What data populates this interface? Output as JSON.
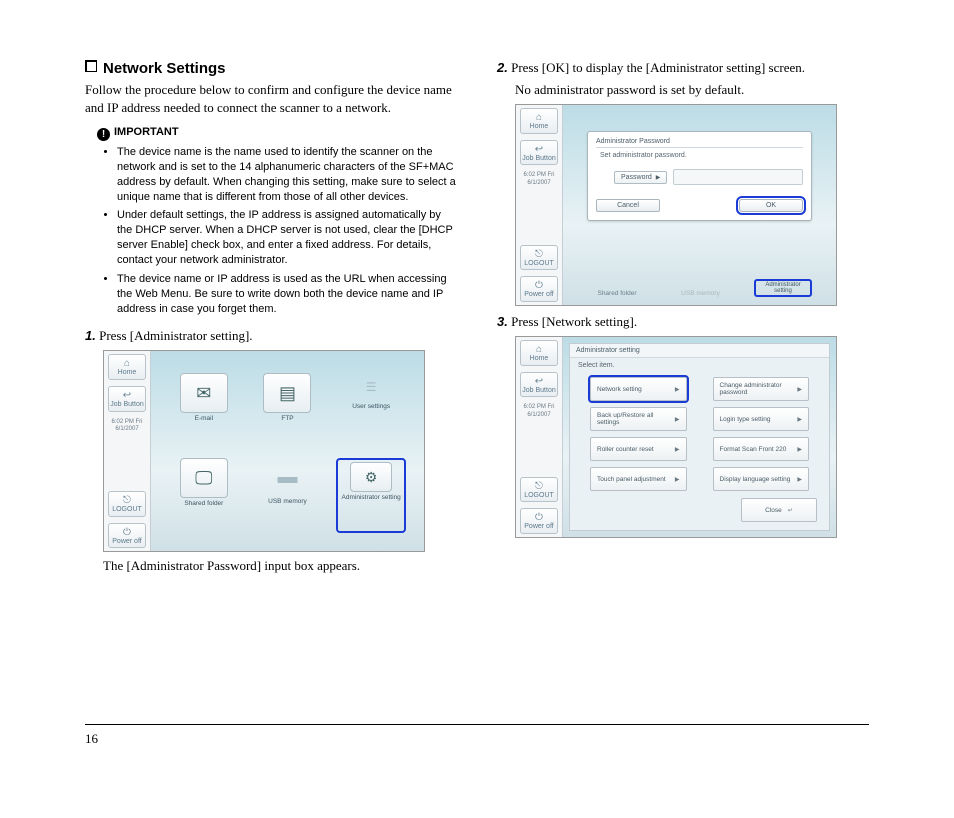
{
  "page_number": "16",
  "section": {
    "title": "Network Settings",
    "intro": "Follow the procedure below to confirm and configure the device name and IP address needed to connect the scanner to a network."
  },
  "important": {
    "label": "IMPORTANT",
    "items": [
      "The device name is the name used to identify the scanner on the network and is set to the 14 alphanumeric characters of the SF+MAC address by default. When changing this setting, make sure to select a unique name that is different from those of all other devices.",
      "Under default settings, the IP address is assigned automatically by the DHCP server. When a DHCP server is not used, clear the [DHCP server Enable] check box, and enter a fixed address. For details, contact your network administrator.",
      "The device name or IP address is used as the URL when accessing the Web Menu. Be sure to write down both the device name and IP address in case you forget them."
    ]
  },
  "steps": {
    "s1": {
      "num": "1.",
      "text": "Press [Administrator setting].",
      "caption": "The [Administrator Password] input box appears."
    },
    "s2": {
      "num": "2.",
      "text": "Press [OK] to display the [Administrator setting] screen.",
      "sub": "No administrator password is set by default."
    },
    "s3": {
      "num": "3.",
      "text": "Press [Network setting]."
    }
  },
  "device": {
    "sidebar": {
      "home": "Home",
      "job": "Job Button",
      "time_line1": "6:02 PM  Fri",
      "time_line2": "6/1/2007",
      "logout": "LOGOUT",
      "power": "Power off"
    },
    "shot1": {
      "email": "E-mail",
      "ftp": "FTP",
      "user_settings": "User settings",
      "shared": "Shared folder",
      "usb": "USB memory",
      "admin": "Administrator setting"
    },
    "shot2": {
      "title": "Administrator Password",
      "sub": "Set administrator password.",
      "password_btn": "Password",
      "cancel": "Cancel",
      "ok": "OK",
      "shared": "Shared folder",
      "usb": "USB memory",
      "admin": "Administrator setting"
    },
    "shot3": {
      "title": "Administrator setting",
      "sub": "Select item.",
      "opts": {
        "net": "Network setting",
        "pw": "Change administrator password",
        "backup": "Back up/Restore all settings",
        "login": "Login type setting",
        "roller": "Roller counter reset",
        "format": "Format Scan Front 220",
        "touch": "Touch panel adjustment",
        "lang": "Display language setting"
      },
      "close": "Close"
    }
  }
}
